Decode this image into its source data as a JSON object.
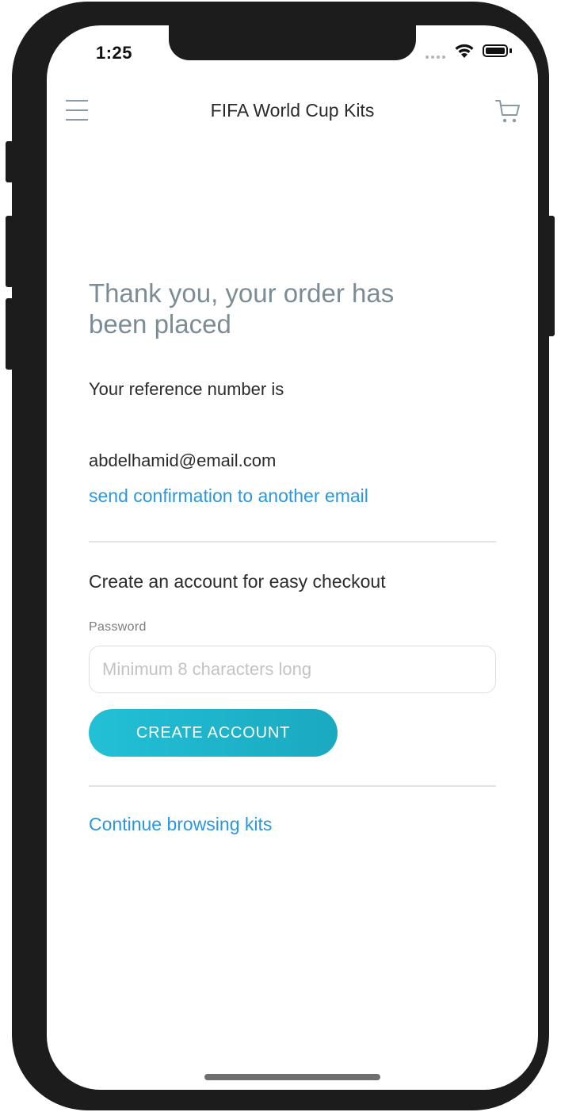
{
  "status_bar": {
    "time": "1:25"
  },
  "nav": {
    "title": "FIFA World Cup Kits",
    "menu_icon": "hamburger-menu-icon",
    "cart_icon": "shopping-cart-icon"
  },
  "confirmation": {
    "heading": "Thank you, your order has been placed",
    "reference_label": "Your reference number is",
    "email": "abdelhamid@email.com",
    "send_link": "send confirmation to another email"
  },
  "account": {
    "prompt": "Create an account for easy checkout",
    "password_label": "Password",
    "password_placeholder": "Minimum 8 characters long",
    "button_label": "CREATE ACCOUNT"
  },
  "footer": {
    "continue_link": "Continue browsing kits"
  },
  "colors": {
    "accent_link": "#2a97e0",
    "button_gradient_start": "#22c0d6",
    "button_gradient_end": "#1aa9c0",
    "heading": "#7b8c96"
  }
}
